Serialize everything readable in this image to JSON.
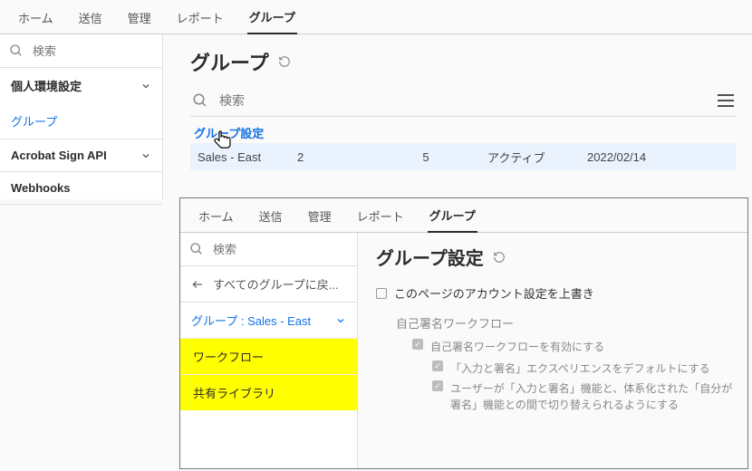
{
  "top": {
    "tabs": [
      "ホーム",
      "送信",
      "管理",
      "レポート",
      "グループ"
    ],
    "active_tab": 4,
    "sidebar": {
      "search_placeholder": "検索",
      "items": [
        {
          "label": "個人環境設定",
          "bold": true,
          "chevron": true,
          "link": false
        },
        {
          "label": "グループ",
          "bold": false,
          "chevron": false,
          "link": true
        },
        {
          "label": "Acrobat Sign API",
          "bold": true,
          "chevron": true,
          "link": false
        },
        {
          "label": "Webhooks",
          "bold": true,
          "chevron": false,
          "link": false
        }
      ]
    },
    "main": {
      "title": "グループ",
      "search_placeholder": "検索",
      "group_settings_link": "グループ設定",
      "row": {
        "name": "Sales - East",
        "col_a": "2",
        "col_b": "5",
        "status": "アクティブ",
        "date": "2022/02/14"
      }
    }
  },
  "inset": {
    "tabs": [
      "ホーム",
      "送信",
      "管理",
      "レポート",
      "グループ"
    ],
    "active_tab": 4,
    "sidebar": {
      "search_placeholder": "検索",
      "back_label": "すべてのグループに戻...",
      "group_label_prefix": "グループ : ",
      "group_name": "Sales - East",
      "highlight_items": [
        "ワークフロー",
        "共有ライブラリ"
      ]
    },
    "main": {
      "title": "グループ設定",
      "override_label": "このページのアカウント設定を上書き",
      "section_title": "自己署名ワークフロー",
      "opt1": "自己署名ワークフローを有効にする",
      "opt2": "「入力と署名」エクスペリエンスをデフォルトにする",
      "opt3": "ユーザーが「入力と署名」機能と、体系化された「自分が署名」機能との間で切り替えられるようにする"
    }
  }
}
